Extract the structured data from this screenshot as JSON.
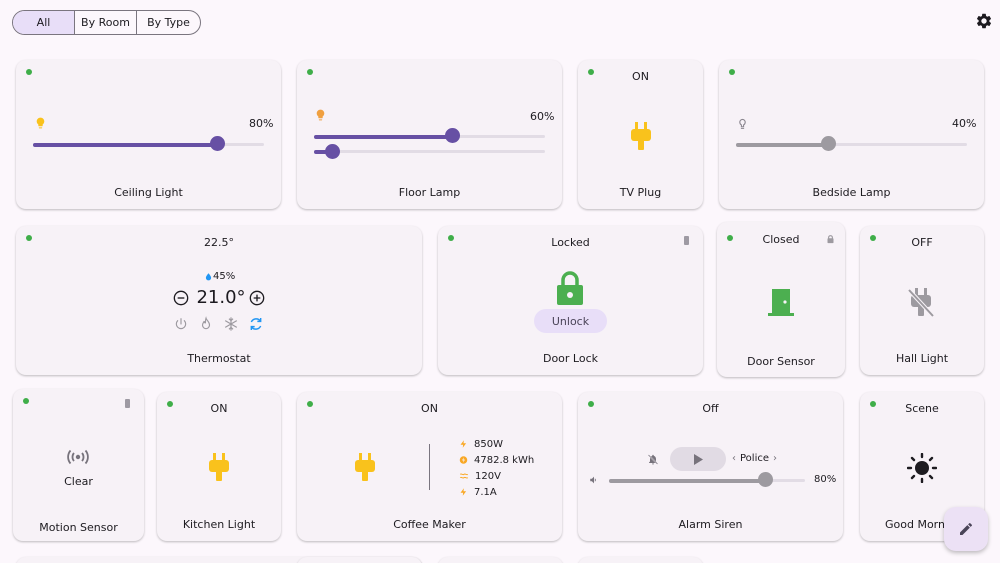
{
  "filter": {
    "segments": [
      {
        "label": "All",
        "active": true
      },
      {
        "label": "By Room",
        "active": false
      },
      {
        "label": "By Type",
        "active": false
      }
    ]
  },
  "header": {
    "settings_icon": "gear-icon"
  },
  "cards": {
    "ceiling_light": {
      "name": "Ceiling Light",
      "brightness_label": "80%",
      "brightness": 0.8
    },
    "floor_lamp": {
      "name": "Floor Lamp",
      "brightness_label": "60%",
      "brightness": 0.6,
      "secondary_level": 0.08
    },
    "tv_plug": {
      "name": "TV Plug",
      "status": "ON"
    },
    "bedside_lamp": {
      "name": "Bedside Lamp",
      "brightness_label": "40%",
      "brightness": 0.4
    },
    "thermostat": {
      "name": "Thermostat",
      "current_temp": "22.5°",
      "humidity": "45%",
      "target_temp": "21.0°"
    },
    "door_lock": {
      "name": "Door Lock",
      "status": "Locked",
      "action": "Unlock"
    },
    "door_sensor": {
      "name": "Door Sensor",
      "status": "Closed"
    },
    "hall_light": {
      "name": "Hall Light",
      "status": "OFF"
    },
    "motion_sensor": {
      "name": "Motion Sensor",
      "state": "Clear"
    },
    "kitchen_light": {
      "name": "Kitchen Light",
      "status": "ON"
    },
    "coffee_maker": {
      "name": "Coffee Maker",
      "status": "ON",
      "power": "850W",
      "energy": "4782.8 kWh",
      "voltage": "120V",
      "current": "7.1A"
    },
    "alarm_siren": {
      "name": "Alarm Siren",
      "status": "Off",
      "tone": "Police",
      "volume_label": "80%",
      "volume": 0.8
    },
    "good_morning": {
      "name": "Good Morn",
      "status": "Scene"
    }
  },
  "colors": {
    "accent": "#6750a4",
    "online": "#3fae49",
    "plug": "#f9c21c",
    "lock": "#4caf50",
    "bulb_on": "#f9c21c",
    "bulb_warm": "#f0a040",
    "info": "#2196f3"
  },
  "fab": {
    "icon": "pencil-icon"
  }
}
